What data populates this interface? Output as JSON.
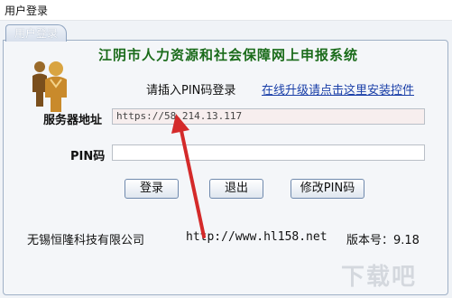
{
  "window": {
    "title": "用户登录"
  },
  "tab": {
    "label": "用户登录"
  },
  "header": {
    "system_title": "江阴市人力资源和社会保障网上申报系统"
  },
  "login": {
    "prompt": "请插入PIN码登录",
    "install_link": "在线升级请点击这里安装控件",
    "server_label": "服务器地址",
    "server_value": "https://58.214.13.117",
    "pin_label": "PIN码",
    "pin_value": ""
  },
  "buttons": {
    "login": "登录",
    "exit": "退出",
    "change_pin": "修改PIN码"
  },
  "footer": {
    "company": "无锡恒隆科技有限公司",
    "url": "http://www.hl158.net",
    "version": "版本号：9.18"
  },
  "colors": {
    "title_green": "#1a6b1a",
    "link_blue": "#1a3fa8",
    "annotation_arrow": "#d42a2a"
  },
  "icons": [
    "users-icon"
  ],
  "watermark": "下载吧"
}
